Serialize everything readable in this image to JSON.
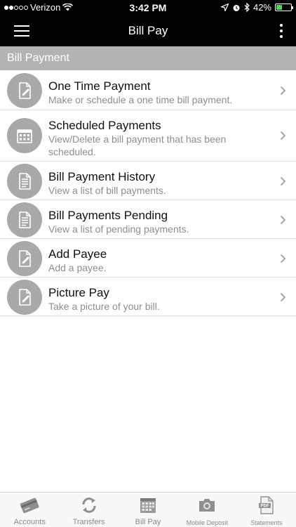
{
  "status_bar": {
    "carrier": "Verizon",
    "time": "3:42 PM",
    "battery_percent": "42%",
    "battery_level": 0.42,
    "battery_color": "#4cd964"
  },
  "nav": {
    "title": "Bill Pay",
    "menu_icon": "hamburger-menu-icon",
    "more_icon": "vertical-dots-icon"
  },
  "section": {
    "title": "Bill Payment"
  },
  "items": [
    {
      "title": "One Time Payment",
      "subtitle": "Make or schedule a one time bill payment.",
      "icon": "document-pen-icon"
    },
    {
      "title": "Scheduled Payments",
      "subtitle": "View/Delete a bill payment that has been scheduled.",
      "icon": "calendar-icon"
    },
    {
      "title": "Bill Payment History",
      "subtitle": "View a list of bill payments.",
      "icon": "document-list-icon"
    },
    {
      "title": "Bill Payments Pending",
      "subtitle": "View a list of pending payments.",
      "icon": "document-list-icon"
    },
    {
      "title": "Add Payee",
      "subtitle": "Add a payee.",
      "icon": "document-pen-icon"
    },
    {
      "title": "Picture Pay",
      "subtitle": "Take a picture of your bill.",
      "icon": "document-pen-icon"
    }
  ],
  "tabs": [
    {
      "label": "Accounts",
      "icon": "card-icon"
    },
    {
      "label": "Transfers",
      "icon": "transfer-arrows-icon"
    },
    {
      "label": "Bill Pay",
      "icon": "calendar-icon"
    },
    {
      "label": "Mobile Deposit",
      "icon": "camera-icon"
    },
    {
      "label": "Statements",
      "icon": "pdf-icon"
    }
  ],
  "colors": {
    "bar_background": "#000000",
    "section_header": "#b3b3b3",
    "icon_circle": "#a9a9a9",
    "subtitle_text": "#8e8e8e"
  }
}
